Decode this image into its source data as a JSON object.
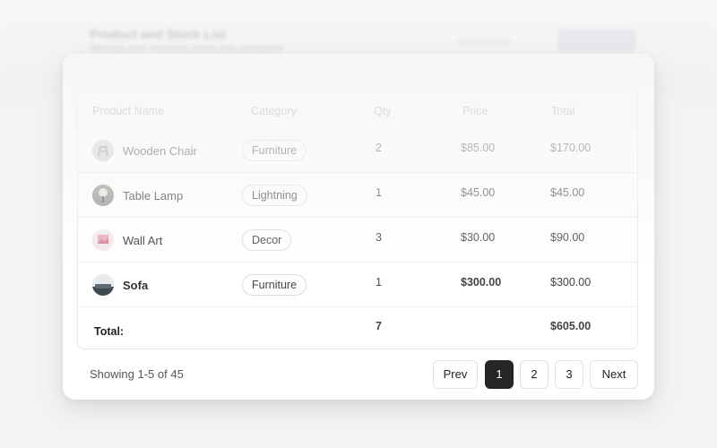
{
  "background": {
    "title": "Product and Stock List",
    "subtitle": "Manage your inventory items and categories"
  },
  "table": {
    "headers": [
      "Product Name",
      "Category",
      "Qty",
      "Price",
      "Total"
    ],
    "rows": [
      {
        "name": "Wooden Chair",
        "category": "Furniture",
        "qty": "2",
        "price": "$85.00",
        "total": "$170.00",
        "thumb": "chair-thumbnail"
      },
      {
        "name": "Table Lamp",
        "category": "Lightning",
        "qty": "1",
        "price": "$45.00",
        "total": "$45.00",
        "thumb": "lamp-thumbnail"
      },
      {
        "name": "Wall Art",
        "category": "Decor",
        "qty": "3",
        "price": "$30.00",
        "total": "$90.00",
        "thumb": "wall-art-thumbnail"
      },
      {
        "name": "Sofa",
        "category": "Furniture",
        "qty": "1",
        "price": "$300.00",
        "total": "$300.00",
        "thumb": "sofa-thumbnail"
      }
    ],
    "footer": {
      "label": "Total:",
      "qty": "7",
      "total": "$605.00"
    }
  },
  "pagination": {
    "showing": "Showing 1-5 of 45",
    "prev": "Prev",
    "pages": [
      "1",
      "2",
      "3"
    ],
    "active_page": "1",
    "next": "Next"
  },
  "colors": {
    "active_page_bg": "#252525",
    "background": "#f3f3f3",
    "card": "#ffffff"
  }
}
